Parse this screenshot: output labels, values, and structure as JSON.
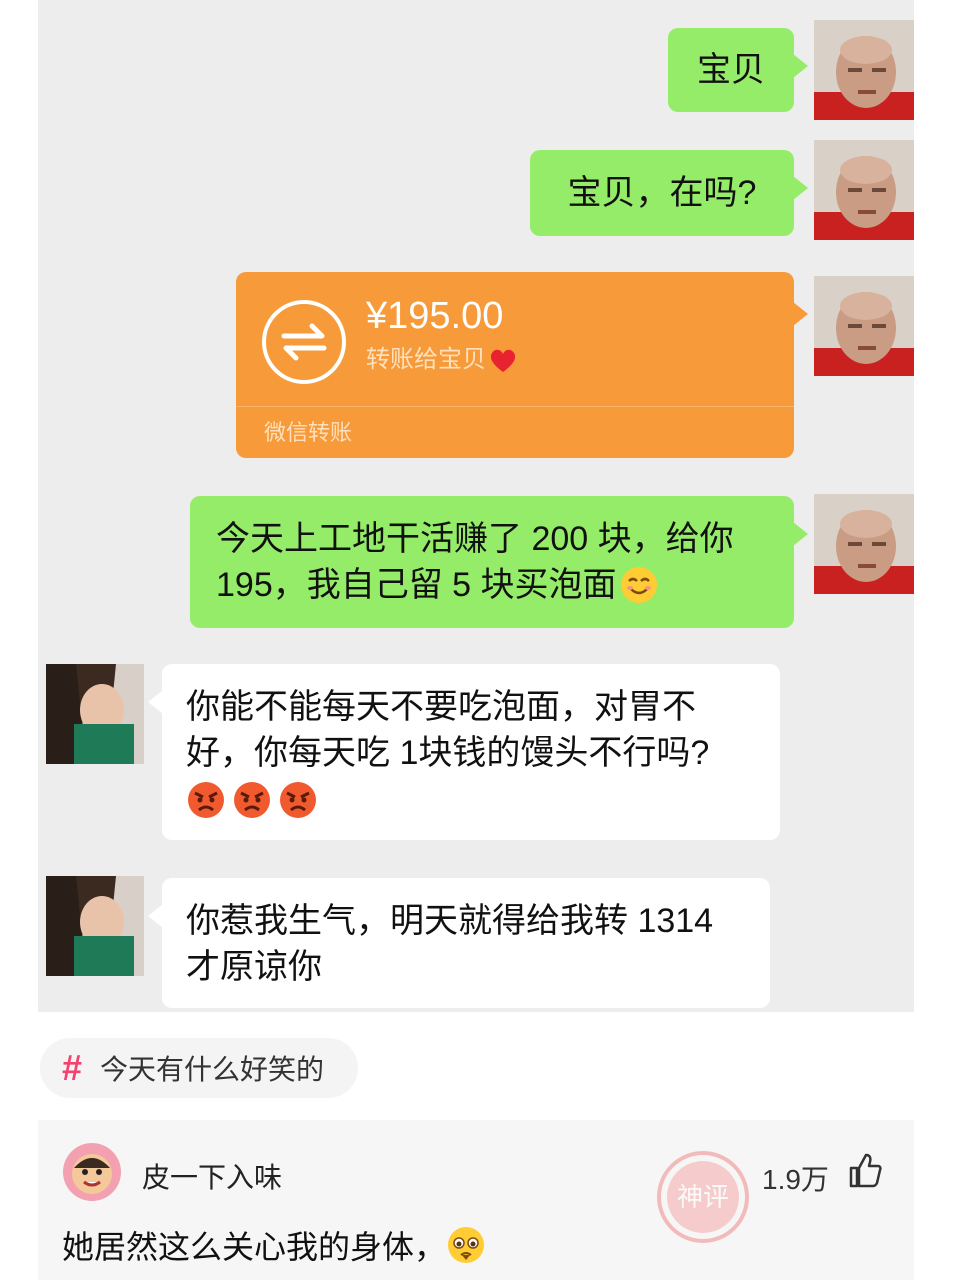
{
  "messages": {
    "m1": "宝贝",
    "m2": "宝贝，在吗?",
    "transfer": {
      "amount": "¥195.00",
      "note": "转账给宝贝",
      "footer": "微信转账"
    },
    "m4_line1": "今天上工地干活赚了 200 块，给你",
    "m4_line2": "195，我自己留 5 块买泡面",
    "m5_line1": "你能不能每天不要吃泡面，对胃不",
    "m5_line2": "好，你每天吃 1块钱的馒头不行吗?",
    "m6_line1": "你惹我生气，明天就得给我转 1314",
    "m6_line2": "才原谅你"
  },
  "topic": {
    "hash": "#",
    "label": "今天有什么好笑的"
  },
  "comment": {
    "username": "皮一下入味",
    "likes": "1.9万",
    "text": "她居然这么关心我的身体，",
    "stamp_text": "神评"
  },
  "colors": {
    "chat_bg": "#ededed",
    "sent_bubble": "#95ec69",
    "received_bubble": "#ffffff",
    "transfer": "#f79b3a",
    "hashtag": "#f5416e"
  },
  "icons": [
    "transfer-icon",
    "heart-icon",
    "smiling-emoji",
    "angry-emoji",
    "like-icon",
    "pleading-emoji",
    "stamp"
  ]
}
